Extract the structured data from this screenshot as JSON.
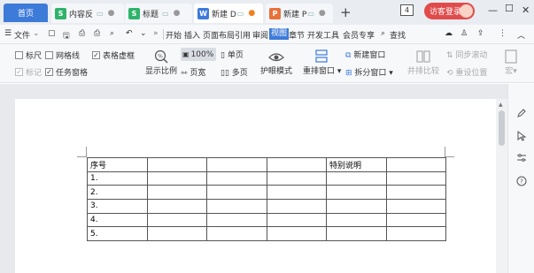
{
  "tabs": {
    "home": "首页",
    "items": [
      {
        "badge": "S",
        "badge_color": "#2fb36a",
        "label": "内容反",
        "active": false
      },
      {
        "badge": "S",
        "badge_color": "#2fb36a",
        "label": "标题",
        "active": false
      },
      {
        "badge": "W",
        "badge_color": "#3d7bd9",
        "label": "新建 D",
        "active": true
      },
      {
        "badge": "P",
        "badge_color": "#e8703a",
        "label": "新建 P",
        "active": false
      }
    ],
    "new_tab": "+",
    "count": "4",
    "login": "访客登录"
  },
  "menu": {
    "file": "文件",
    "items": [
      "开始",
      "插入",
      "页面布局",
      "引用",
      "审阅",
      "视图",
      "章节",
      "开发工具",
      "会员专享"
    ],
    "active": "视图",
    "search": "查找"
  },
  "ribbon": {
    "checkboxes_row1": [
      {
        "label": "标尺",
        "checked": false,
        "dim": false
      },
      {
        "label": "网格线",
        "checked": false,
        "dim": false
      },
      {
        "label": "表格虚框",
        "checked": true,
        "dim": false
      }
    ],
    "checkboxes_row2": [
      {
        "label": "标记",
        "checked": true,
        "dim": true
      },
      {
        "label": "任务窗格",
        "checked": true,
        "dim": false
      }
    ],
    "display_ratio": "显示比例",
    "zoom": "100%",
    "page_width": "页宽",
    "single_page": "单页",
    "multi_page": "多页",
    "eye_mode": "护眼模式",
    "rearrange": "重排窗口",
    "new_window": "新建窗口",
    "split_window": "拆分窗口",
    "side_by_side": "并排比较",
    "sync_scroll": "同步滚动",
    "reset_position": "重设位置",
    "macro": "宏"
  },
  "document": {
    "table": [
      [
        "序号",
        "",
        "",
        "",
        "特别说明",
        ""
      ],
      [
        "1.",
        "",
        "",
        "",
        "",
        ""
      ],
      [
        "2.",
        "",
        "",
        "",
        "",
        ""
      ],
      [
        "3.",
        "",
        "",
        "",
        "",
        ""
      ],
      [
        "4.",
        "",
        "",
        "",
        "",
        ""
      ],
      [
        "5.",
        "",
        "",
        "",
        "",
        ""
      ]
    ]
  },
  "colors": {
    "accent": "#3d7bd9",
    "login": "#e04b4b",
    "sheet_badge": "#2fb36a",
    "ppt_badge": "#e8703a"
  }
}
